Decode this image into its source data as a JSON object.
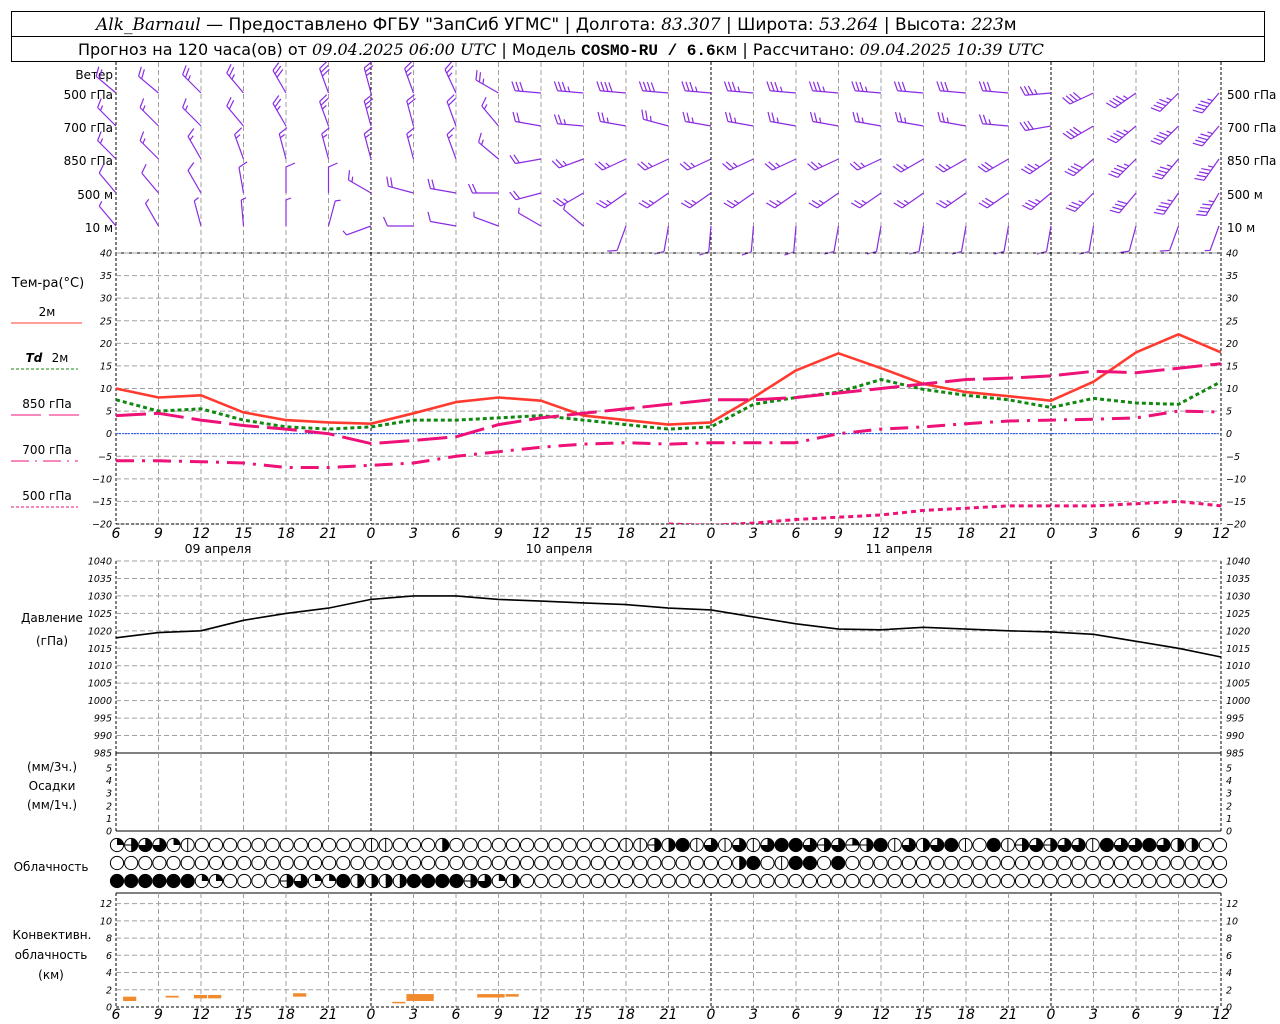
{
  "header": {
    "station": "Alk_Barnaul",
    "provider": " — Предоставлено ФГБУ \"ЗапСиб УГМС\" | Долгота: ",
    "lon": "83.307",
    "lat_label": " | Широта: ",
    "lat": "53.264",
    "alt_label": " | Высота: ",
    "alt": "223",
    "alt_unit": "м",
    "forecast_label": "Прогноз на 120 часа(ов) от ",
    "forecast_time": "09.04.2025 06:00 UTC",
    "model_label": " | Модель ",
    "model": "COSMO-RU / 6.6",
    "model_unit": "км",
    "calc_label": " | Рассчитано: ",
    "calc_time": "09.04.2025 10:39 UTC"
  },
  "labels": {
    "wind": "Ветер",
    "levels": [
      "500 гПа",
      "700 гПа",
      "850 гПа",
      "500 м",
      "10  м"
    ],
    "temp_title": "Тем-ра(°C)",
    "t2m": "2м",
    "td_sym": "Td",
    "td_lvl": "2м",
    "t850": "850 гПа",
    "t700": "700 гПа",
    "t500": "500 гПа",
    "pressure": "Давление",
    "pressure_unit": "(гПа)",
    "precip_3h": "(мм/3ч.)",
    "precip": "Осадки",
    "precip_1h": "(мм/1ч.)",
    "clouds": "Облачность",
    "conv1": "Конвективн.",
    "conv2": "облачность",
    "conv3": "(км)"
  },
  "colors": {
    "wind": "#8a2be2",
    "t2m": "#ff3b30",
    "td2m": "#118811",
    "upper_temp": "#ee1177",
    "zero_line": "#2255ff",
    "convective": "#f08a2c",
    "grid": "#a0a0a0"
  },
  "time_axis": {
    "hour_labels": [
      "6",
      "9",
      "12",
      "15",
      "18",
      "21",
      "0",
      "3",
      "6",
      "9",
      "12",
      "15",
      "18",
      "21",
      "0",
      "3",
      "6",
      "9",
      "12",
      "15",
      "18",
      "21",
      "0",
      "3",
      "6",
      "9",
      "12"
    ],
    "dates": [
      "09 апреля",
      "10 апреля",
      "11 апреля"
    ]
  },
  "chart_data": [
    {
      "type": "wind_barbs",
      "title": "Ветер",
      "units": "m/s",
      "levels": [
        {
          "name": "500 гПа",
          "dir": [
            310,
            310,
            315,
            320,
            330,
            340,
            345,
            340,
            335,
            300,
            275,
            275,
            275,
            275,
            275,
            275,
            275,
            275,
            275,
            275,
            275,
            275,
            265,
            245,
            235,
            225,
            220
          ],
          "speed": [
            10,
            10,
            12,
            14,
            16,
            15,
            14,
            12,
            12,
            12,
            15,
            18,
            20,
            20,
            18,
            18,
            17,
            18,
            18,
            16,
            16,
            16,
            18,
            20,
            22,
            22,
            22
          ]
        },
        {
          "name": "700 гПа",
          "dir": [
            315,
            315,
            315,
            320,
            330,
            340,
            345,
            345,
            340,
            320,
            280,
            275,
            280,
            285,
            280,
            280,
            280,
            280,
            280,
            280,
            280,
            275,
            260,
            240,
            230,
            225,
            220
          ],
          "speed": [
            8,
            8,
            8,
            10,
            12,
            14,
            12,
            10,
            10,
            8,
            10,
            12,
            12,
            14,
            14,
            12,
            12,
            12,
            14,
            14,
            14,
            14,
            16,
            20,
            22,
            22,
            22
          ]
        },
        {
          "name": "850 гПа",
          "dir": [
            315,
            315,
            330,
            340,
            345,
            345,
            345,
            345,
            340,
            310,
            260,
            250,
            245,
            245,
            245,
            245,
            245,
            245,
            245,
            240,
            240,
            240,
            235,
            230,
            225,
            220,
            215
          ],
          "speed": [
            8,
            8,
            8,
            8,
            8,
            8,
            8,
            8,
            8,
            8,
            10,
            12,
            12,
            12,
            12,
            12,
            14,
            14,
            14,
            14,
            14,
            16,
            18,
            20,
            22,
            22,
            22
          ]
        },
        {
          "name": "500 м",
          "dir": [
            320,
            320,
            330,
            350,
            0,
            0,
            300,
            285,
            280,
            270,
            255,
            240,
            235,
            235,
            235,
            235,
            235,
            235,
            235,
            235,
            235,
            235,
            230,
            225,
            220,
            215,
            210
          ],
          "speed": [
            6,
            6,
            6,
            6,
            6,
            6,
            8,
            10,
            10,
            10,
            10,
            12,
            12,
            12,
            12,
            14,
            14,
            14,
            14,
            14,
            14,
            16,
            18,
            18,
            20,
            22,
            22
          ]
        },
        {
          "name": "10 м",
          "dir": [
            320,
            330,
            345,
            355,
            0,
            15,
            250,
            270,
            280,
            290,
            300,
            310,
            200,
            190,
            185,
            185,
            185,
            190,
            190,
            190,
            190,
            190,
            190,
            190,
            195,
            200,
            200
          ],
          "speed": [
            4,
            4,
            4,
            3,
            3,
            3,
            4,
            5,
            5,
            4,
            4,
            4,
            5,
            5,
            5,
            5,
            5,
            5,
            5,
            5,
            5,
            5,
            5,
            5,
            5,
            5,
            4
          ]
        }
      ]
    },
    {
      "type": "line",
      "ylabel": "Тем-ра(°C)",
      "ylim": [
        -20,
        40
      ],
      "yticks": [
        40,
        35,
        30,
        25,
        20,
        15,
        10,
        5,
        0,
        -5,
        -10,
        -15,
        -20
      ],
      "grid": true,
      "series": [
        {
          "name": "2м",
          "values": [
            10,
            8,
            8.5,
            4.7,
            3,
            2.5,
            2.2,
            4.5,
            7,
            8,
            7.3,
            4,
            3,
            2,
            2.5,
            8,
            14,
            17.8,
            14.5,
            11,
            9.2,
            8.3,
            7.3,
            11.5,
            18,
            22,
            18
          ]
        },
        {
          "name": "Td 2м",
          "values": [
            7.5,
            5,
            5.5,
            3,
            1.5,
            1,
            1.5,
            3,
            3,
            3.5,
            4,
            3,
            2,
            1,
            1.5,
            6.5,
            8,
            9.2,
            12,
            9.8,
            8.5,
            7.5,
            5.8,
            7.8,
            6.8,
            6.5,
            11.5
          ]
        },
        {
          "name": "850 гПа",
          "values": [
            4,
            4.5,
            3,
            1.8,
            1,
            0,
            -2.2,
            -1.5,
            -0.7,
            2,
            3.5,
            4.5,
            5.5,
            6.5,
            7.5,
            7.5,
            8,
            9,
            10,
            11,
            12,
            12.3,
            12.8,
            13.8,
            13.5,
            14.5,
            15.5
          ]
        },
        {
          "name": "700 гПа",
          "values": [
            -6,
            -6,
            -6.2,
            -6.5,
            -7.5,
            -7.5,
            -7,
            -6.5,
            -5,
            -4,
            -3,
            -2.3,
            -2,
            -2.3,
            -2,
            -2,
            -2,
            0,
            1,
            1.5,
            2.2,
            2.8,
            3,
            3.2,
            3.5,
            5,
            4.8
          ]
        },
        {
          "name": "500 гПа",
          "values": [
            null,
            null,
            null,
            null,
            null,
            null,
            null,
            null,
            null,
            null,
            null,
            null,
            null,
            -20,
            -20.3,
            -19.8,
            -19,
            -18.5,
            -18,
            -17,
            -16.5,
            -16,
            -16,
            -16,
            -15.5,
            -15,
            -16
          ]
        }
      ]
    },
    {
      "type": "line",
      "ylabel": "Давление (гПа)",
      "ylim": [
        985,
        1040
      ],
      "yticks": [
        1040,
        1035,
        1030,
        1025,
        1020,
        1015,
        1010,
        1005,
        1000,
        995,
        990,
        985
      ],
      "grid": true,
      "values": [
        1018,
        1019.5,
        1020,
        1023,
        1025,
        1026.5,
        1029,
        1030,
        1030,
        1029,
        1028.5,
        1028,
        1027.5,
        1026.5,
        1026,
        1024,
        1022,
        1020.5,
        1020.3,
        1021,
        1020.5,
        1020,
        1019.7,
        1019,
        1017,
        1015,
        1012.5
      ]
    },
    {
      "type": "bar",
      "ylabel": "Осадки",
      "ylim": [
        0,
        5
      ],
      "yticks": [
        5,
        4,
        3,
        2,
        1,
        0
      ],
      "values": [
        0,
        0,
        0,
        0,
        0,
        0,
        0,
        0,
        0,
        0,
        0,
        0,
        0,
        0,
        0,
        0,
        0,
        0,
        0,
        0,
        0,
        0,
        0,
        0,
        0,
        0,
        0
      ]
    },
    {
      "type": "cloud_symbols",
      "ylabel": "Облачность",
      "units": "octas, hourly",
      "rows": [
        [
          2,
          5,
          6,
          6,
          2,
          1,
          0,
          0,
          0,
          0,
          0,
          0,
          0,
          0,
          0,
          0,
          0,
          0,
          1,
          1,
          0,
          0,
          0,
          4,
          0,
          0,
          0,
          0,
          0,
          0,
          0,
          0,
          0,
          0,
          0,
          0,
          1,
          1,
          5,
          4,
          8,
          1,
          6,
          1,
          6,
          1,
          6,
          8,
          8,
          6,
          5,
          6,
          3,
          5,
          8,
          1,
          6,
          4,
          6,
          8,
          1,
          0,
          8,
          1,
          5,
          6,
          5,
          6,
          6,
          1,
          8,
          6,
          6,
          8,
          6,
          4,
          4,
          0,
          0
        ],
        [
          0,
          0,
          0,
          0,
          0,
          0,
          0,
          0,
          0,
          0,
          0,
          0,
          0,
          0,
          0,
          0,
          0,
          0,
          0,
          0,
          0,
          0,
          0,
          0,
          0,
          0,
          0,
          0,
          0,
          0,
          0,
          0,
          0,
          0,
          0,
          0,
          0,
          0,
          0,
          0,
          0,
          0,
          0,
          0,
          4,
          8,
          0,
          1,
          8,
          8,
          0,
          8,
          0,
          0,
          0,
          0,
          0,
          0,
          0,
          0,
          0,
          0,
          0,
          0,
          0,
          0,
          0,
          0,
          0,
          0,
          0,
          0,
          0,
          0,
          0,
          0,
          0,
          0,
          0
        ],
        [
          8,
          8,
          8,
          8,
          8,
          8,
          2,
          2,
          0,
          0,
          0,
          0,
          5,
          6,
          2,
          2,
          8,
          4,
          4,
          4,
          4,
          8,
          8,
          8,
          8,
          5,
          6,
          2,
          4,
          0,
          0,
          0,
          0,
          0,
          0,
          0,
          0,
          0,
          0,
          0,
          0,
          0,
          0,
          0,
          0,
          0,
          0,
          0,
          0,
          0,
          0,
          0,
          0,
          0,
          0,
          0,
          0,
          0,
          0,
          0,
          0,
          0,
          0,
          0,
          0,
          0,
          0,
          0,
          0,
          0,
          0,
          0,
          0,
          0,
          0,
          0,
          0,
          0,
          0
        ]
      ]
    },
    {
      "type": "range_bar",
      "ylabel": "Конвективн. облачность (км)",
      "ylim": [
        0,
        13
      ],
      "yticks": [
        12,
        10,
        8,
        6,
        4,
        2,
        0
      ],
      "bars": [
        {
          "date": "09.04",
          "from": "06:30",
          "to": "07:30",
          "base_km": 0.7,
          "top_km": 1.2
        },
        {
          "date": "09.04",
          "from": "09:30",
          "to": "10:30",
          "base_km": 1.1,
          "top_km": 1.3
        },
        {
          "date": "09.04",
          "from": "11:30",
          "to": "12:30",
          "base_km": 1.0,
          "top_km": 1.4
        },
        {
          "date": "09.04",
          "from": "12:30",
          "to": "13:30",
          "base_km": 1.0,
          "top_km": 1.4
        },
        {
          "date": "09.04",
          "from": "18:30",
          "to": "19:30",
          "base_km": 1.2,
          "top_km": 1.6
        },
        {
          "date": "10.04",
          "from": "01:30",
          "to": "02:30",
          "base_km": 0.5,
          "top_km": 0.6
        },
        {
          "date": "10.04",
          "from": "02:30",
          "to": "04:30",
          "base_km": 0.7,
          "top_km": 1.5
        },
        {
          "date": "10.04",
          "from": "07:30",
          "to": "09:30",
          "base_km": 1.1,
          "top_km": 1.5
        },
        {
          "date": "10.04",
          "from": "09:30",
          "to": "10:30",
          "base_km": 1.2,
          "top_km": 1.5
        }
      ]
    }
  ]
}
